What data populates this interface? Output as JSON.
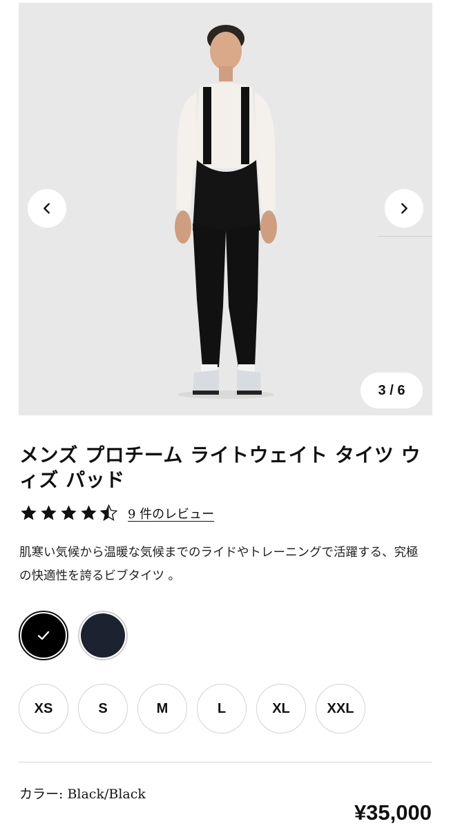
{
  "gallery": {
    "counter": "3 / 6",
    "prev_icon": "chevron-left-icon",
    "next_icon": "chevron-right-icon",
    "current_index": 3,
    "total": 6
  },
  "product": {
    "title": "メンズ プロチーム ライトウェイト タイツ ウィズ パッド",
    "rating": 4.5,
    "review_link": "9 件のレビュー",
    "description": "肌寒い気候から温暖な気候までのライドやトレーニングで活躍する、究極の快適性を誇るビブタイツ 。"
  },
  "colors": {
    "options": [
      {
        "name": "Black/Black",
        "hex": "#000000",
        "selected": true
      },
      {
        "name": "Navy",
        "hex": "#1d2230",
        "selected": false
      }
    ],
    "check_icon": "check-icon"
  },
  "sizes": [
    "XS",
    "S",
    "M",
    "L",
    "XL",
    "XXL"
  ],
  "footer": {
    "color_label": "カラー: Black/Black",
    "price": "¥35,000"
  }
}
